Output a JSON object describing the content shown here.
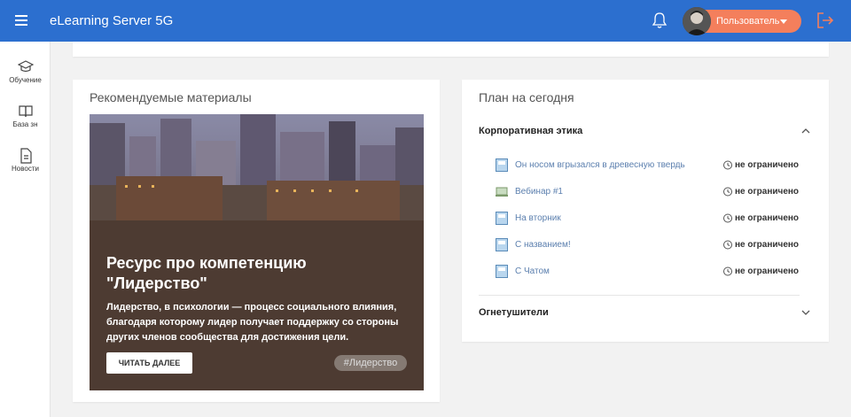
{
  "header": {
    "app_title": "eLearning Server 5G",
    "user_label": "Пользователь",
    "icons": [
      "menu-icon",
      "bell-icon",
      "logout-icon"
    ],
    "accent_color": "#2c6fcf",
    "user_button_color": "#f47f5c"
  },
  "sidebar": {
    "items": [
      {
        "label": "Обучение",
        "icon": "graduation-cap-icon"
      },
      {
        "label": "База зн",
        "icon": "book-icon"
      },
      {
        "label": "Новости",
        "icon": "document-icon"
      }
    ]
  },
  "recommended": {
    "title": "Рекомендуемые материалы",
    "heading": "Ресурс про компетенцию \"Лидерство\"",
    "text": "Лидерство, в психологии — процесс социального влияния, благодаря которому лидер получает поддержку со стороны других членов сообщества для достижения цели.",
    "read_more": "ЧИТАТЬ ДАЛЕЕ",
    "tag": "#Лидерство"
  },
  "plan": {
    "title": "План на сегодня",
    "sections": [
      {
        "title": "Корпоративная этика",
        "expanded": true,
        "items": [
          {
            "name": "Он носом вгрызался в древесную твердь",
            "icon": "course-icon",
            "time": "не ограничено"
          },
          {
            "name": "Вебинар #1",
            "icon": "webinar-icon",
            "time": "не ограничено"
          },
          {
            "name": "На вторник",
            "icon": "course-icon",
            "time": "не ограничено"
          },
          {
            "name": "С названием!",
            "icon": "course-icon",
            "time": "не ограничено"
          },
          {
            "name": "С Чатом",
            "icon": "course-icon",
            "time": "не ограничено"
          }
        ]
      },
      {
        "title": "Огнетушители",
        "expanded": false,
        "items": []
      }
    ]
  }
}
